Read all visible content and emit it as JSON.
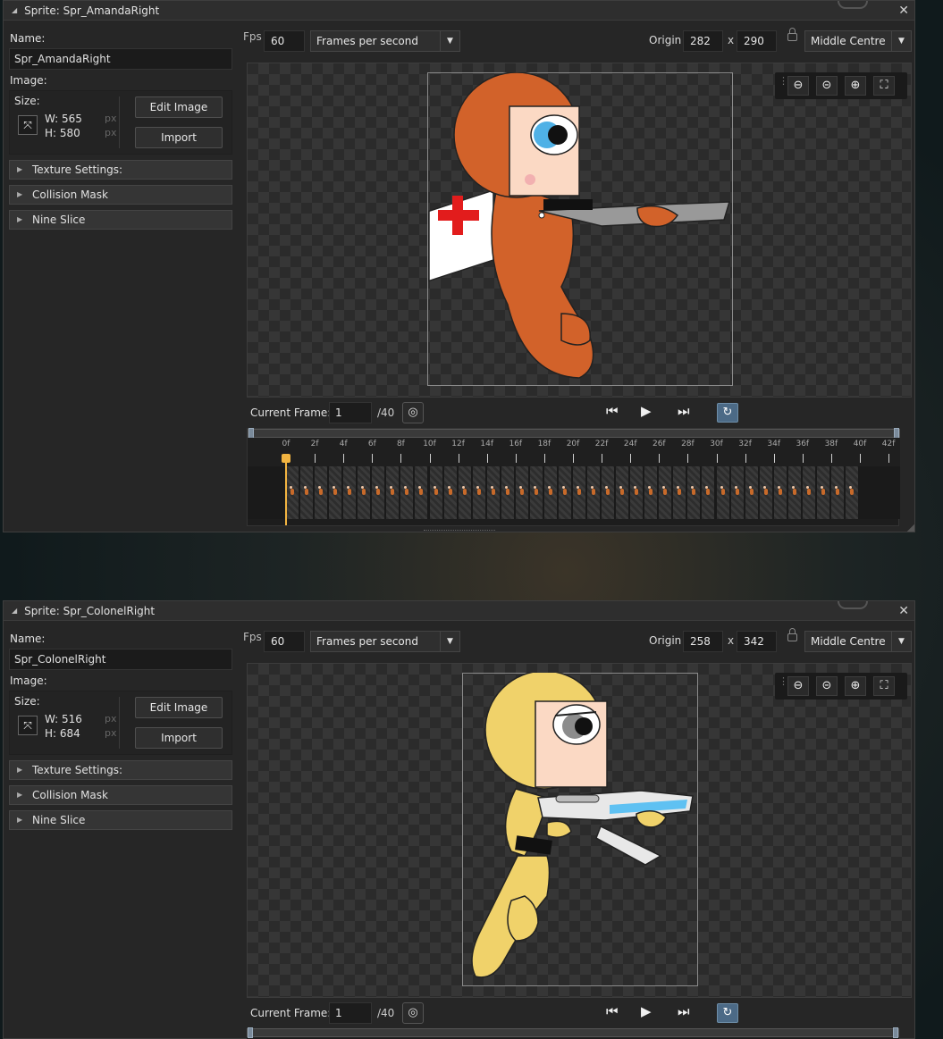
{
  "windows": [
    {
      "title": "Sprite: Spr_AmandaRight",
      "name_label": "Name:",
      "name_value": "Spr_AmandaRight",
      "image_label": "Image:",
      "size_label": "Size:",
      "width": "W: 565",
      "height": "H: 580",
      "px": "px",
      "edit_image": "Edit Image",
      "import": "Import",
      "sections": [
        "Texture Settings:",
        "Collision Mask",
        "Nine Slice"
      ],
      "fps_label": "Fps",
      "fps_value": "60",
      "fps_mode": "Frames per second",
      "origin_label": "Origin",
      "origin_x": "282",
      "origin_sep": "x",
      "origin_y": "290",
      "origin_mode": "Middle Centre",
      "current_frame_label": "Current Frame:",
      "current_frame": "1",
      "frame_total": "/40",
      "sprite_color": "#d2622a",
      "tick_labels": [
        "0f",
        "2f",
        "4f",
        "6f",
        "8f",
        "10f",
        "12f",
        "14f",
        "16f",
        "18f",
        "20f",
        "22f",
        "24f",
        "26f",
        "28f",
        "30f",
        "32f",
        "34f",
        "36f",
        "38f",
        "40f",
        "42f"
      ]
    },
    {
      "title": "Sprite: Spr_ColonelRight",
      "name_label": "Name:",
      "name_value": "Spr_ColonelRight",
      "image_label": "Image:",
      "size_label": "Size:",
      "width": "W: 516",
      "height": "H: 684",
      "px": "px",
      "edit_image": "Edit Image",
      "import": "Import",
      "sections": [
        "Texture Settings:",
        "Collision Mask",
        "Nine Slice"
      ],
      "fps_label": "Fps",
      "fps_value": "60",
      "fps_mode": "Frames per second",
      "origin_label": "Origin",
      "origin_x": "258",
      "origin_sep": "x",
      "origin_y": "342",
      "origin_mode": "Middle Centre",
      "current_frame_label": "Current Frame:",
      "current_frame": "1",
      "frame_total": "/40",
      "sprite_color": "#f0d26a"
    }
  ],
  "icons": {
    "close": "close-icon",
    "zoom_fit": "zoom-fit-icon",
    "zoom_out": "zoom-out-icon",
    "zoom_in": "zoom-in-icon",
    "fullscreen": "fullscreen-icon",
    "onion": "onion-skin-icon",
    "first": "skip-first-icon",
    "play": "play-icon",
    "last": "skip-last-icon",
    "loop": "loop-icon",
    "lock": "lock-icon",
    "resize": "resize-icon"
  },
  "accent_color": "#f2b441"
}
